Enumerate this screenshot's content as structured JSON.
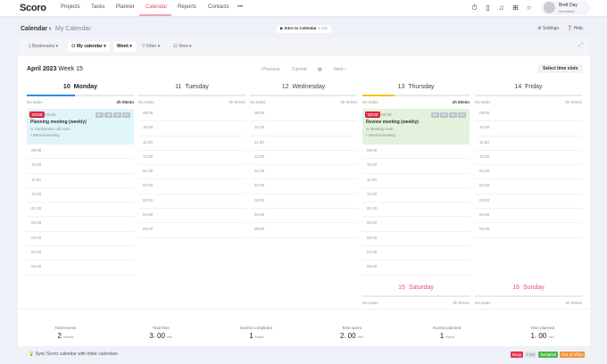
{
  "nav": {
    "logo": "Scoro",
    "items": [
      "Projects",
      "Tasks",
      "Planner",
      "Calendar",
      "Reports",
      "Contacts"
    ],
    "active": "Calendar",
    "more": "•••",
    "icons": [
      "timer-icon",
      "bookmark-icon",
      "bell-icon",
      "plus-square-icon",
      "search-icon"
    ],
    "user": {
      "name": "Brett Day",
      "org": "Moonshot"
    }
  },
  "breadcrumb": {
    "root": "Calendar",
    "current": "My Calendar"
  },
  "intro": {
    "label": "Intro to Calendar",
    "duration": "1 min"
  },
  "header_links": {
    "settings": "Settings",
    "help": "Help"
  },
  "toolbar": {
    "bookmarks": "Bookmarks",
    "my_calendar": "My calendar",
    "week": "Week",
    "filter": "Filter",
    "view": "View"
  },
  "week": {
    "month": "April 2023",
    "week": "Week 15",
    "previous": "‹ Previous",
    "current": "Current",
    "next": "Next ›",
    "select_slots": "Select time slots"
  },
  "days": [
    {
      "num": "10",
      "name": "Monday",
      "bold": true,
      "tasks": "No tasks",
      "time": "2h 00min",
      "time_bold": true,
      "indicator": "#2d8ae6",
      "indicator_fill": 0.45,
      "event": {
        "start": "03:00",
        "end": "04:00",
        "title": "Planning meeting (weekly)",
        "location": "Conference call room",
        "type": "Internal meeting",
        "color": "#e0f5f9",
        "initials": [
          "BD",
          "JM",
          "JN",
          "KH"
        ]
      }
    },
    {
      "num": "11",
      "name": "Tuesday",
      "tasks": "No tasks",
      "time": "0h 00min"
    },
    {
      "num": "12",
      "name": "Wednesday",
      "tasks": "No tasks",
      "time": "0h 00min"
    },
    {
      "num": "13",
      "name": "Thursday",
      "tasks": "No tasks",
      "time": "1h 00min",
      "time_bold": true,
      "indicator": "#f5c518",
      "indicator_fill": 0.3,
      "event": {
        "start": "03:00",
        "end": "04:00",
        "title": "Review meeting (weekly)",
        "location": "Meeting room",
        "type": "Internal meeting",
        "color": "#e2f2dc",
        "initials": [
          "BD",
          "JM",
          "JN",
          "KH"
        ]
      }
    },
    {
      "num": "14",
      "name": "Friday",
      "tasks": "No tasks",
      "time": "0h 00min"
    },
    {
      "num": "15",
      "name": "Saturday",
      "weekend": true,
      "tasks": "No tasks",
      "time": "0h 00min"
    },
    {
      "num": "16",
      "name": "Sunday",
      "weekend": true,
      "tasks": "No tasks",
      "time": "0h 00min"
    }
  ],
  "slots": [
    "09:00",
    "10:00",
    "11:00",
    "12:00",
    "01:00",
    "02:00",
    "03:00",
    "04:00",
    "05:00"
  ],
  "stats": [
    {
      "label": "Total events",
      "value": "2",
      "unit": "events"
    },
    {
      "label": "Total time",
      "value": "3",
      "unit_h": "h",
      "value2": "00",
      "unit": "min"
    },
    {
      "label": "Events completed",
      "value": "1",
      "unit": "event"
    },
    {
      "label": "Time spent",
      "value": "2",
      "unit_h": "h",
      "value2": "00",
      "unit": "min"
    },
    {
      "label": "Events planned",
      "value": "1",
      "unit": "event"
    },
    {
      "label": "Time planned",
      "value": "1",
      "unit_h": "h",
      "value2": "00",
      "unit": "min"
    }
  ],
  "footer": {
    "sync": "Sync Scoro calendar with other calendars",
    "legend": [
      {
        "label": "Busy",
        "color": "#e8324f"
      },
      {
        "label": "Free",
        "color": "#dfe3ea"
      },
      {
        "label": "Tentative",
        "color": "#4cb848"
      },
      {
        "label": "Out of office",
        "color": "#f5923e"
      }
    ]
  }
}
